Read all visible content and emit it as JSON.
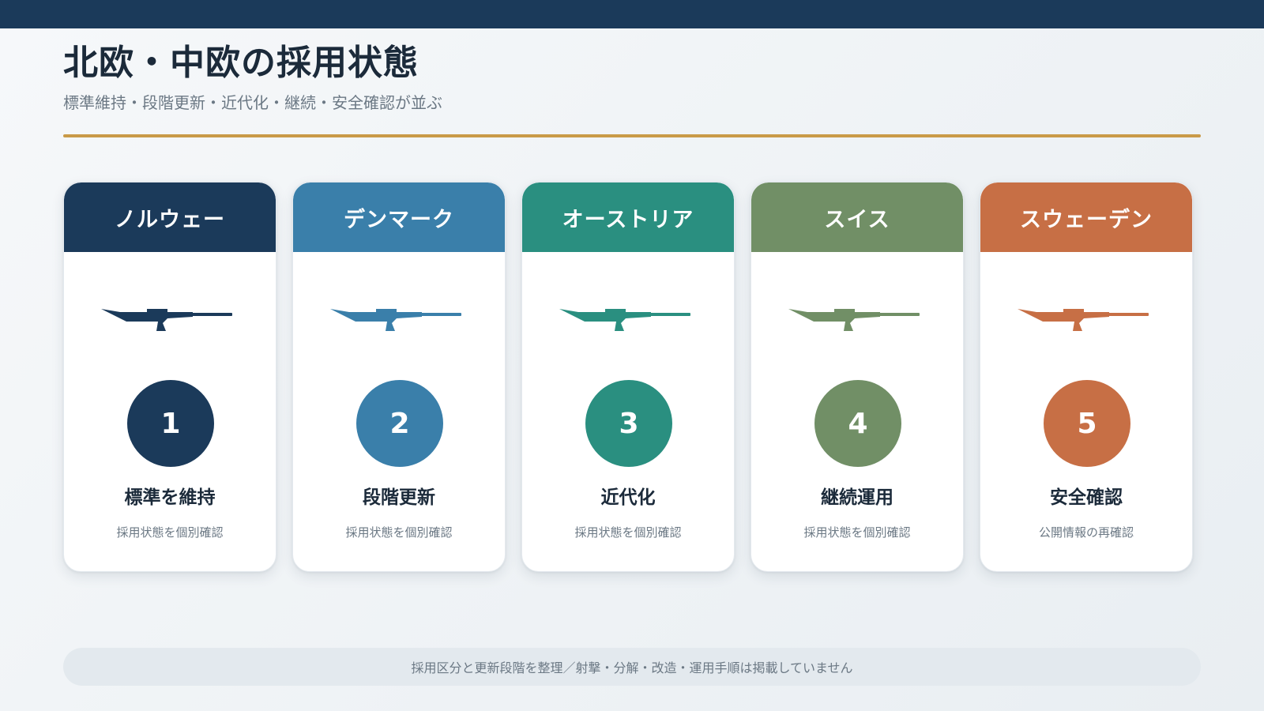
{
  "header": {
    "title": "北欧・中欧の採用状態",
    "subtitle": "標準維持・段階更新・近代化・継続・安全確認が並ぶ"
  },
  "cards": [
    {
      "country": "ノルウェー",
      "number": "1",
      "label": "標準を維持",
      "desc": "採用状態を個別確認",
      "color": "#1b3a5a",
      "icon": "rifle-icon"
    },
    {
      "country": "デンマーク",
      "number": "2",
      "label": "段階更新",
      "desc": "採用状態を個別確認",
      "color": "#3a7faa",
      "icon": "rifle-icon"
    },
    {
      "country": "オーストリア",
      "number": "3",
      "label": "近代化",
      "desc": "採用状態を個別確認",
      "color": "#2a8f80",
      "icon": "rifle-icon"
    },
    {
      "country": "スイス",
      "number": "4",
      "label": "継続運用",
      "desc": "採用状態を個別確認",
      "color": "#718f66",
      "icon": "rifle-icon"
    },
    {
      "country": "スウェーデン",
      "number": "5",
      "label": "安全確認",
      "desc": "公開情報の再確認",
      "color": "#c76f45",
      "icon": "rifle-icon"
    }
  ],
  "footer": {
    "note": "採用区分と更新段階を整理／射撃・分解・改造・運用手順は掲載していません"
  }
}
